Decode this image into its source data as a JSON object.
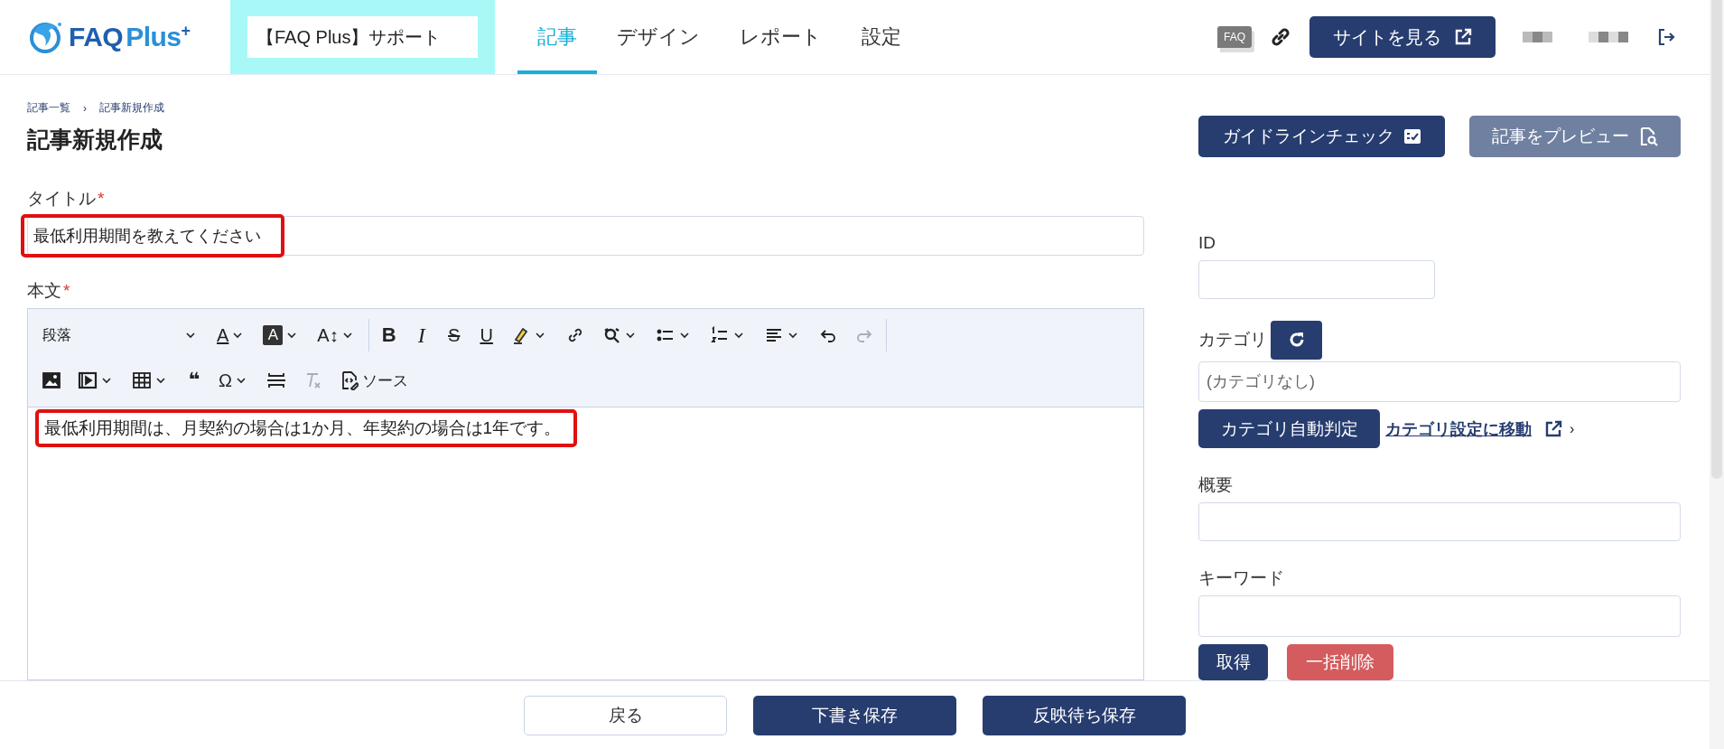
{
  "header": {
    "logo": {
      "main": "FAQ",
      "accent": "Plus",
      "sup": "+"
    },
    "site_selector": "【FAQ Plus】サポート",
    "nav": [
      {
        "label": "記事",
        "selected": true
      },
      {
        "label": "デザイン",
        "selected": false
      },
      {
        "label": "レポート",
        "selected": false
      },
      {
        "label": "設定",
        "selected": false
      }
    ],
    "faq_badge": "FAQ",
    "view_site_button": "サイトを見る"
  },
  "breadcrumb": {
    "items": [
      "記事一覧",
      "記事新規作成"
    ],
    "separator": "›"
  },
  "page_title": "記事新規作成",
  "title_field": {
    "label": "タイトル",
    "required_mark": "*",
    "value": "最低利用期間を教えてください",
    "highlighted": true
  },
  "body_field": {
    "label": "本文",
    "required_mark": "*",
    "toolbar": [
      {
        "groups": [
          [
            {
              "kind": "select",
              "label": "段落",
              "dropdown": true
            },
            {
              "kind": "glyph",
              "glyph": "A",
              "dropdown": true
            },
            {
              "kind": "glyph",
              "glyph": "A",
              "dropdown": true
            },
            {
              "kind": "glyph",
              "glyph": "A↕",
              "dropdown": true
            }
          ],
          [
            {
              "kind": "glyph",
              "glyph": "B",
              "dropdown": false
            },
            {
              "kind": "glyph",
              "glyph": "I",
              "dropdown": false
            },
            {
              "kind": "glyph",
              "glyph": "S",
              "dropdown": false
            },
            {
              "kind": "glyph",
              "glyph": "U",
              "dropdown": false
            },
            {
              "kind": "icon",
              "dropdown": true,
              "disabled": false
            },
            {
              "kind": "icon",
              "dropdown": false,
              "disabled": false
            },
            {
              "kind": "icon",
              "dropdown": true,
              "disabled": false
            },
            {
              "kind": "icon",
              "dropdown": true,
              "disabled": false
            },
            {
              "kind": "icon",
              "dropdown": true,
              "disabled": false
            },
            {
              "kind": "icon",
              "dropdown": true,
              "disabled": false
            },
            {
              "kind": "icon",
              "dropdown": false,
              "disabled": false
            },
            {
              "kind": "icon",
              "dropdown": false,
              "disabled": true
            }
          ]
        ]
      },
      {
        "groups": [
          [
            {
              "kind": "icon",
              "dropdown": false,
              "disabled": false
            },
            {
              "kind": "icon",
              "dropdown": true,
              "disabled": false
            },
            {
              "kind": "icon",
              "dropdown": true,
              "disabled": false
            },
            {
              "kind": "glyph",
              "glyph": "❝",
              "dropdown": false
            },
            {
              "kind": "glyph",
              "glyph": "Ω",
              "dropdown": true
            },
            {
              "kind": "icon",
              "dropdown": false,
              "disabled": false
            },
            {
              "kind": "icon",
              "dropdown": false,
              "disabled": true
            },
            {
              "kind": "icon",
              "dropdown": false,
              "disabled": false,
              "label": "ソース"
            }
          ]
        ]
      }
    ],
    "content": "最低利用期間は、月契約の場合は1か月、年契約の場合は1年です。",
    "highlighted": true
  },
  "actions": [
    {
      "label": "ガイドラインチェック",
      "kind": "primary"
    },
    {
      "label": "記事をプレビュー",
      "kind": "muted"
    }
  ],
  "id_field": {
    "label": "ID"
  },
  "category": {
    "label": "カテゴリ",
    "placeholder": "(カテゴリなし)",
    "auto_button": "カテゴリ自動判定",
    "settings_link": "カテゴリ設定に移動",
    "chevron": "›"
  },
  "summary_field": {
    "label": "概要"
  },
  "keyword_field": {
    "label": "キーワード",
    "buttons": [
      {
        "label": "取得",
        "kind": "primary"
      },
      {
        "label": "一括削除",
        "kind": "danger"
      }
    ]
  },
  "footer_buttons": [
    {
      "label": "戻る",
      "kind": "secondary"
    },
    {
      "label": "下書き保存",
      "kind": "primary"
    },
    {
      "label": "反映待ち保存",
      "kind": "primary"
    }
  ]
}
